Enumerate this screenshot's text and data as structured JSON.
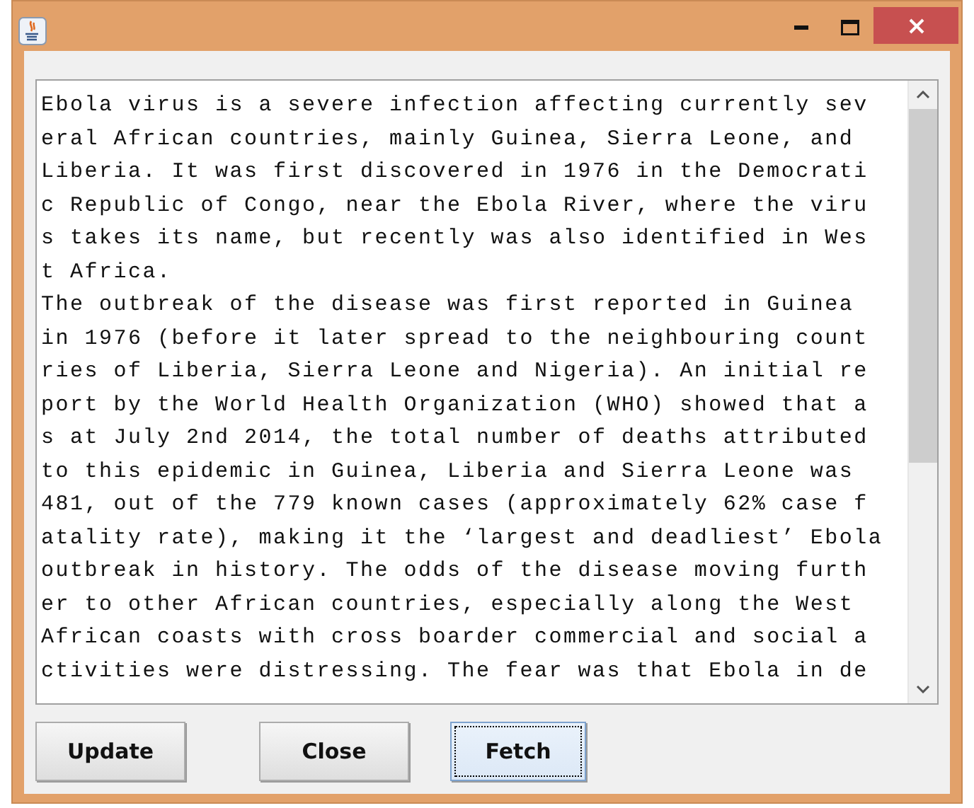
{
  "text_area": {
    "lines": [
      "Ebola virus is a severe infection affecting currently sev",
      "eral African countries, mainly Guinea, Sierra Leone, and",
      "Liberia. It was first discovered in 1976 in the Democrati",
      "c Republic of Congo, near the Ebola River, where the viru",
      "s takes its name, but recently was also identified in Wes",
      "t Africa.",
      "The outbreak of the disease was first reported in Guinea",
      "in 1976 (before it later spread to the neighbouring count",
      "ries of Liberia, Sierra Leone and Nigeria). An initial re",
      "port by the World Health Organization (WHO) showed that a",
      "s at July 2nd 2014, the total number of deaths attributed",
      "to this epidemic in Guinea, Liberia and Sierra Leone was",
      "481, out of the 779 known cases (approximately 62% case f",
      "atality rate), making it the ‘largest and deadliest’ Ebola",
      "outbreak in history. The odds of the disease moving furth",
      "er to other African countries, especially along the West",
      "African coasts with cross boarder commercial and social a",
      "ctivities were distressing. The fear was that Ebola in de"
    ]
  },
  "buttons": [
    {
      "label": "Update",
      "focused": false
    },
    {
      "label": "Close",
      "focused": false
    },
    {
      "label": "Fetch",
      "focused": true
    }
  ]
}
